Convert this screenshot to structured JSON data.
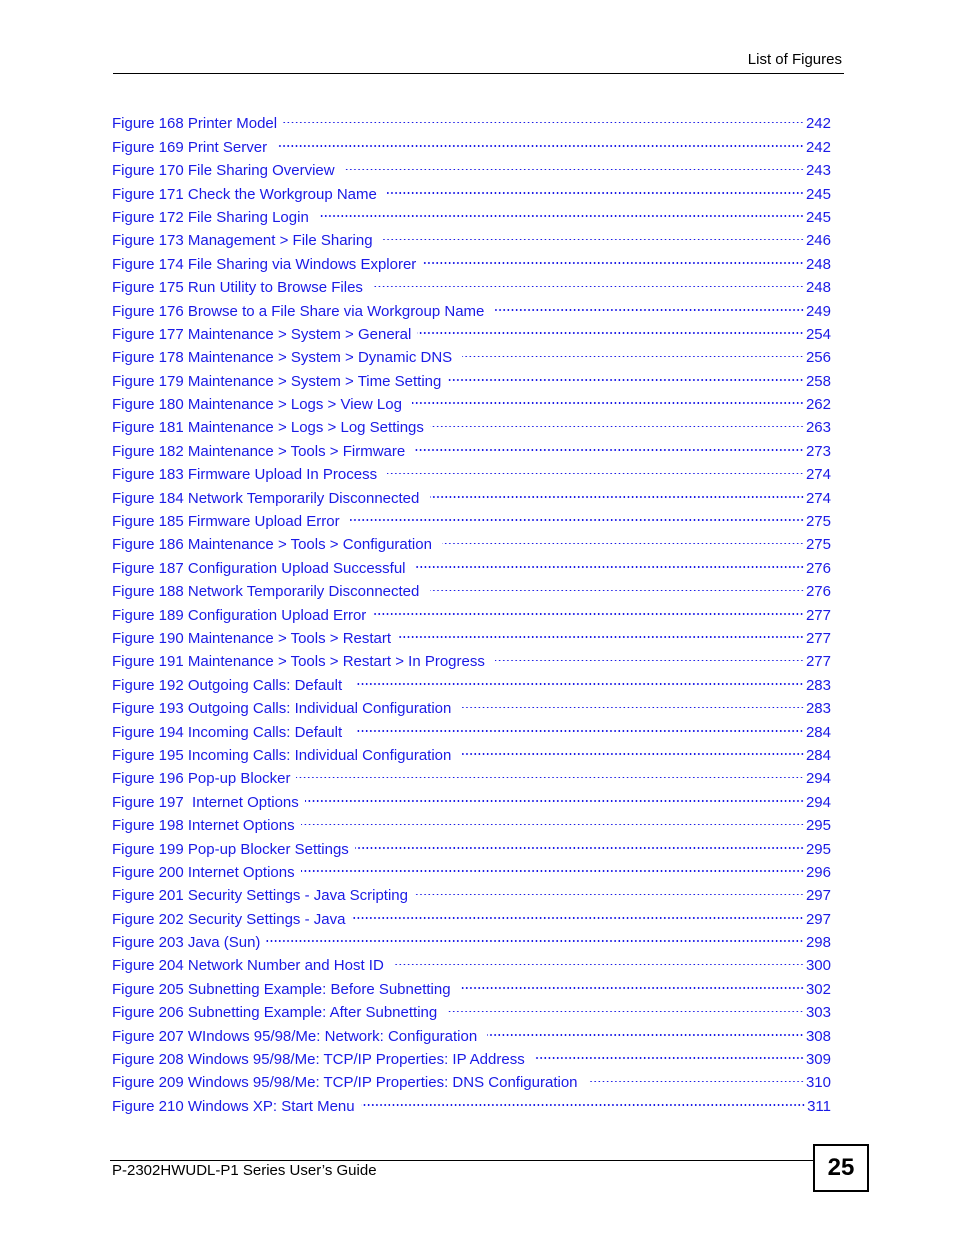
{
  "header": {
    "title": "List of Figures"
  },
  "toc": {
    "entries": [
      {
        "label": "Figure 168 Printer Model",
        "page": "242"
      },
      {
        "label": "Figure 169 Print Server ",
        "page": "242"
      },
      {
        "label": "Figure 170 File Sharing Overview ",
        "page": "243"
      },
      {
        "label": "Figure 171 Check the Workgroup Name ",
        "page": "245"
      },
      {
        "label": "Figure 172 File Sharing Login ",
        "page": "245"
      },
      {
        "label": "Figure 173 Management > File Sharing ",
        "page": "246"
      },
      {
        "label": "Figure 174 File Sharing via Windows Explorer",
        "page": "248"
      },
      {
        "label": "Figure 175 Run Utility to Browse Files ",
        "page": "248"
      },
      {
        "label": "Figure 176 Browse to a File Share via Workgroup Name ",
        "page": "249"
      },
      {
        "label": "Figure 177 Maintenance > System > General",
        "page": "254"
      },
      {
        "label": "Figure 178 Maintenance > System > Dynamic DNS ",
        "page": "256"
      },
      {
        "label": "Figure 179 Maintenance > System > Time Setting",
        "page": "258"
      },
      {
        "label": "Figure 180 Maintenance > Logs > View Log ",
        "page": "262"
      },
      {
        "label": "Figure 181 Maintenance > Logs > Log Settings",
        "page": "263"
      },
      {
        "label": "Figure 182 Maintenance > Tools > Firmware ",
        "page": "273"
      },
      {
        "label": "Figure 183 Firmware Upload In Process ",
        "page": "274"
      },
      {
        "label": "Figure 184 Network Temporarily Disconnected ",
        "page": "274"
      },
      {
        "label": "Figure 185 Firmware Upload Error ",
        "page": "275"
      },
      {
        "label": "Figure 186 Maintenance > Tools > Configuration ",
        "page": "275"
      },
      {
        "label": "Figure 187 Configuration Upload Successful ",
        "page": "276"
      },
      {
        "label": "Figure 188 Network Temporarily Disconnected ",
        "page": "276"
      },
      {
        "label": "Figure 189 Configuration Upload Error",
        "page": "277"
      },
      {
        "label": "Figure 190 Maintenance > Tools > Restart",
        "page": "277"
      },
      {
        "label": "Figure 191 Maintenance > Tools > Restart > In Progress ",
        "page": "277"
      },
      {
        "label": "Figure 192 Outgoing Calls: Default  ",
        "page": "283"
      },
      {
        "label": "Figure 193 Outgoing Calls: Individual Configuration ",
        "page": "283"
      },
      {
        "label": "Figure 194 Incoming Calls: Default  ",
        "page": "284"
      },
      {
        "label": "Figure 195 Incoming Calls: Individual Configuration ",
        "page": "284"
      },
      {
        "label": "Figure 196 Pop-up Blocker",
        "page": "294"
      },
      {
        "label": "Figure 197  Internet Options",
        "page": "294"
      },
      {
        "label": "Figure 198 Internet Options",
        "page": "295"
      },
      {
        "label": "Figure 199 Pop-up Blocker Settings",
        "page": "295"
      },
      {
        "label": "Figure 200 Internet Options",
        "page": "296"
      },
      {
        "label": "Figure 201 Security Settings - Java Scripting",
        "page": "297"
      },
      {
        "label": "Figure 202 Security Settings - Java",
        "page": "297"
      },
      {
        "label": "Figure 203 Java (Sun)",
        "page": "298"
      },
      {
        "label": "Figure 204 Network Number and Host ID ",
        "page": "300"
      },
      {
        "label": "Figure 205 Subnetting Example: Before Subnetting ",
        "page": "302"
      },
      {
        "label": "Figure 206 Subnetting Example: After Subnetting ",
        "page": "303"
      },
      {
        "label": "Figure 207 WIndows 95/98/Me: Network: Configuration ",
        "page": "308"
      },
      {
        "label": "Figure 208 Windows 95/98/Me: TCP/IP Properties: IP Address ",
        "page": "309"
      },
      {
        "label": "Figure 209 Windows 95/98/Me: TCP/IP Properties: DNS Configuration ",
        "page": "310"
      },
      {
        "label": "Figure 210 Windows XP: Start Menu",
        "page": "311"
      }
    ]
  },
  "footer": {
    "guide_title": "P-2302HWUDL-P1 Series User’s Guide",
    "page_number": "25"
  },
  "colors": {
    "link": "#1a1ae6",
    "text": "#000000",
    "background": "#ffffff"
  }
}
